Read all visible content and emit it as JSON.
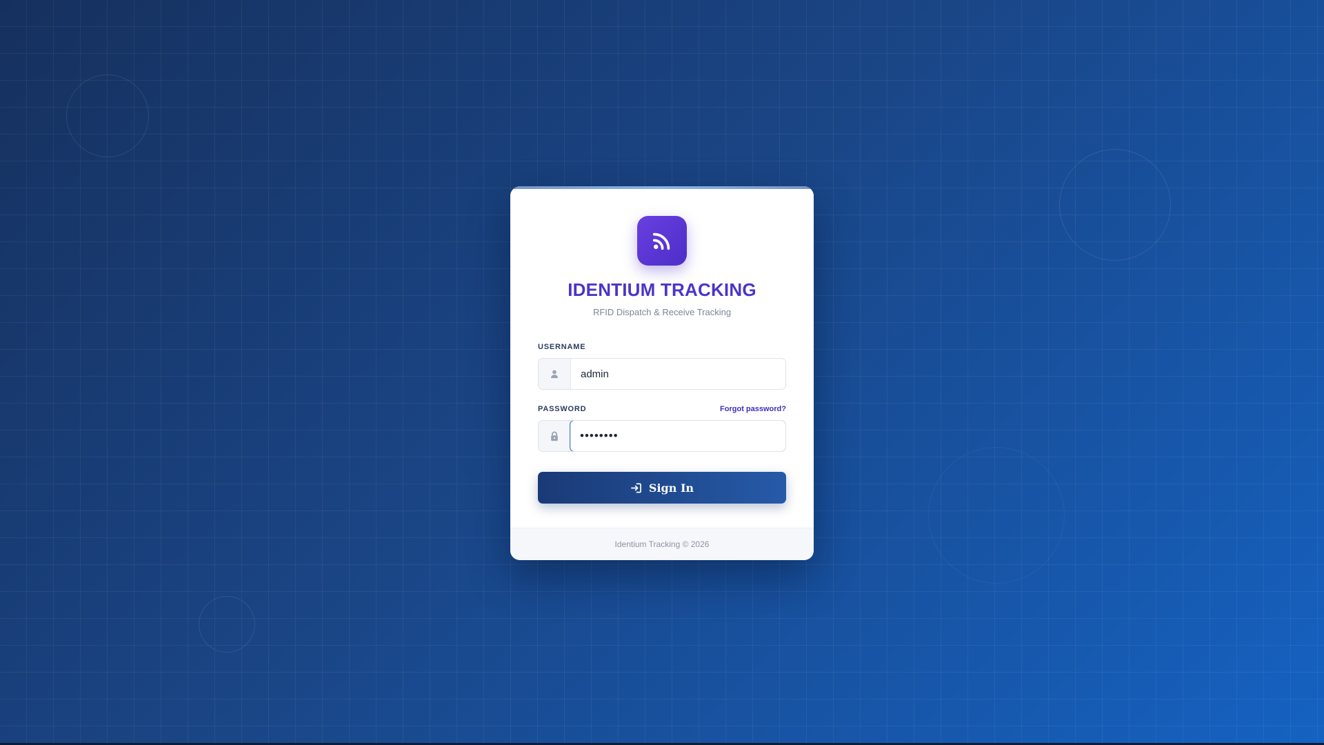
{
  "app": {
    "title": "IDENTIUM TRACKING",
    "subtitle": "RFID Dispatch & Receive Tracking",
    "logo_icon": "rss-icon"
  },
  "form": {
    "username": {
      "label": "USERNAME",
      "value": "admin",
      "icon": "user-icon"
    },
    "password": {
      "label": "PASSWORD",
      "value": "••••••••",
      "icon": "lock-icon",
      "forgot_label": "Forgot password?"
    },
    "submit": {
      "label": "Sign In",
      "icon": "sign-in-icon"
    }
  },
  "footer": {
    "text": "Identium Tracking © 2026"
  },
  "colors": {
    "accent": "#4a35c9",
    "button": "#1f4a8f",
    "background_start": "#16305e",
    "background_end": "#1562c2"
  }
}
